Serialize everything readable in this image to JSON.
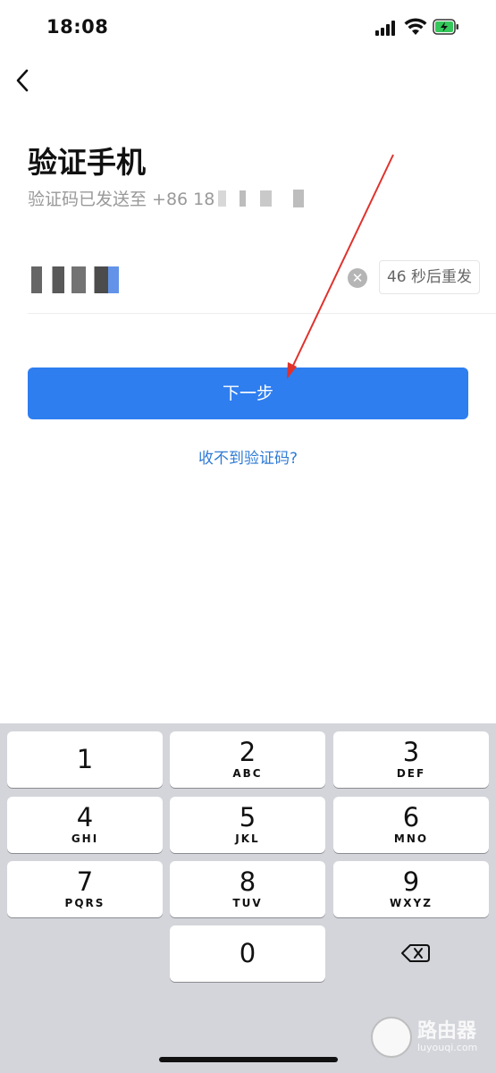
{
  "status": {
    "time": "18:08"
  },
  "page": {
    "title": "验证手机",
    "subtitle_prefix": "验证码已发送至 +86 18",
    "resend_label": "46 秒后重发",
    "clear_symbol": "✕",
    "next_label": "下一步",
    "no_code_link": "收不到验证码?"
  },
  "keyboard": {
    "keys": [
      {
        "num": "1",
        "letters": ""
      },
      {
        "num": "2",
        "letters": "ABC"
      },
      {
        "num": "3",
        "letters": "DEF"
      },
      {
        "num": "4",
        "letters": "GHI"
      },
      {
        "num": "5",
        "letters": "JKL"
      },
      {
        "num": "6",
        "letters": "MNO"
      },
      {
        "num": "7",
        "letters": "PQRS"
      },
      {
        "num": "8",
        "letters": "TUV"
      },
      {
        "num": "9",
        "letters": "WXYZ"
      },
      {
        "num": "0",
        "letters": ""
      }
    ]
  },
  "watermark": {
    "main": "路由器",
    "sub": "luyouqi.com"
  },
  "colors": {
    "accent": "#2e7ef0",
    "link": "#2f7bd5",
    "annotation_arrow": "#e0322c"
  }
}
